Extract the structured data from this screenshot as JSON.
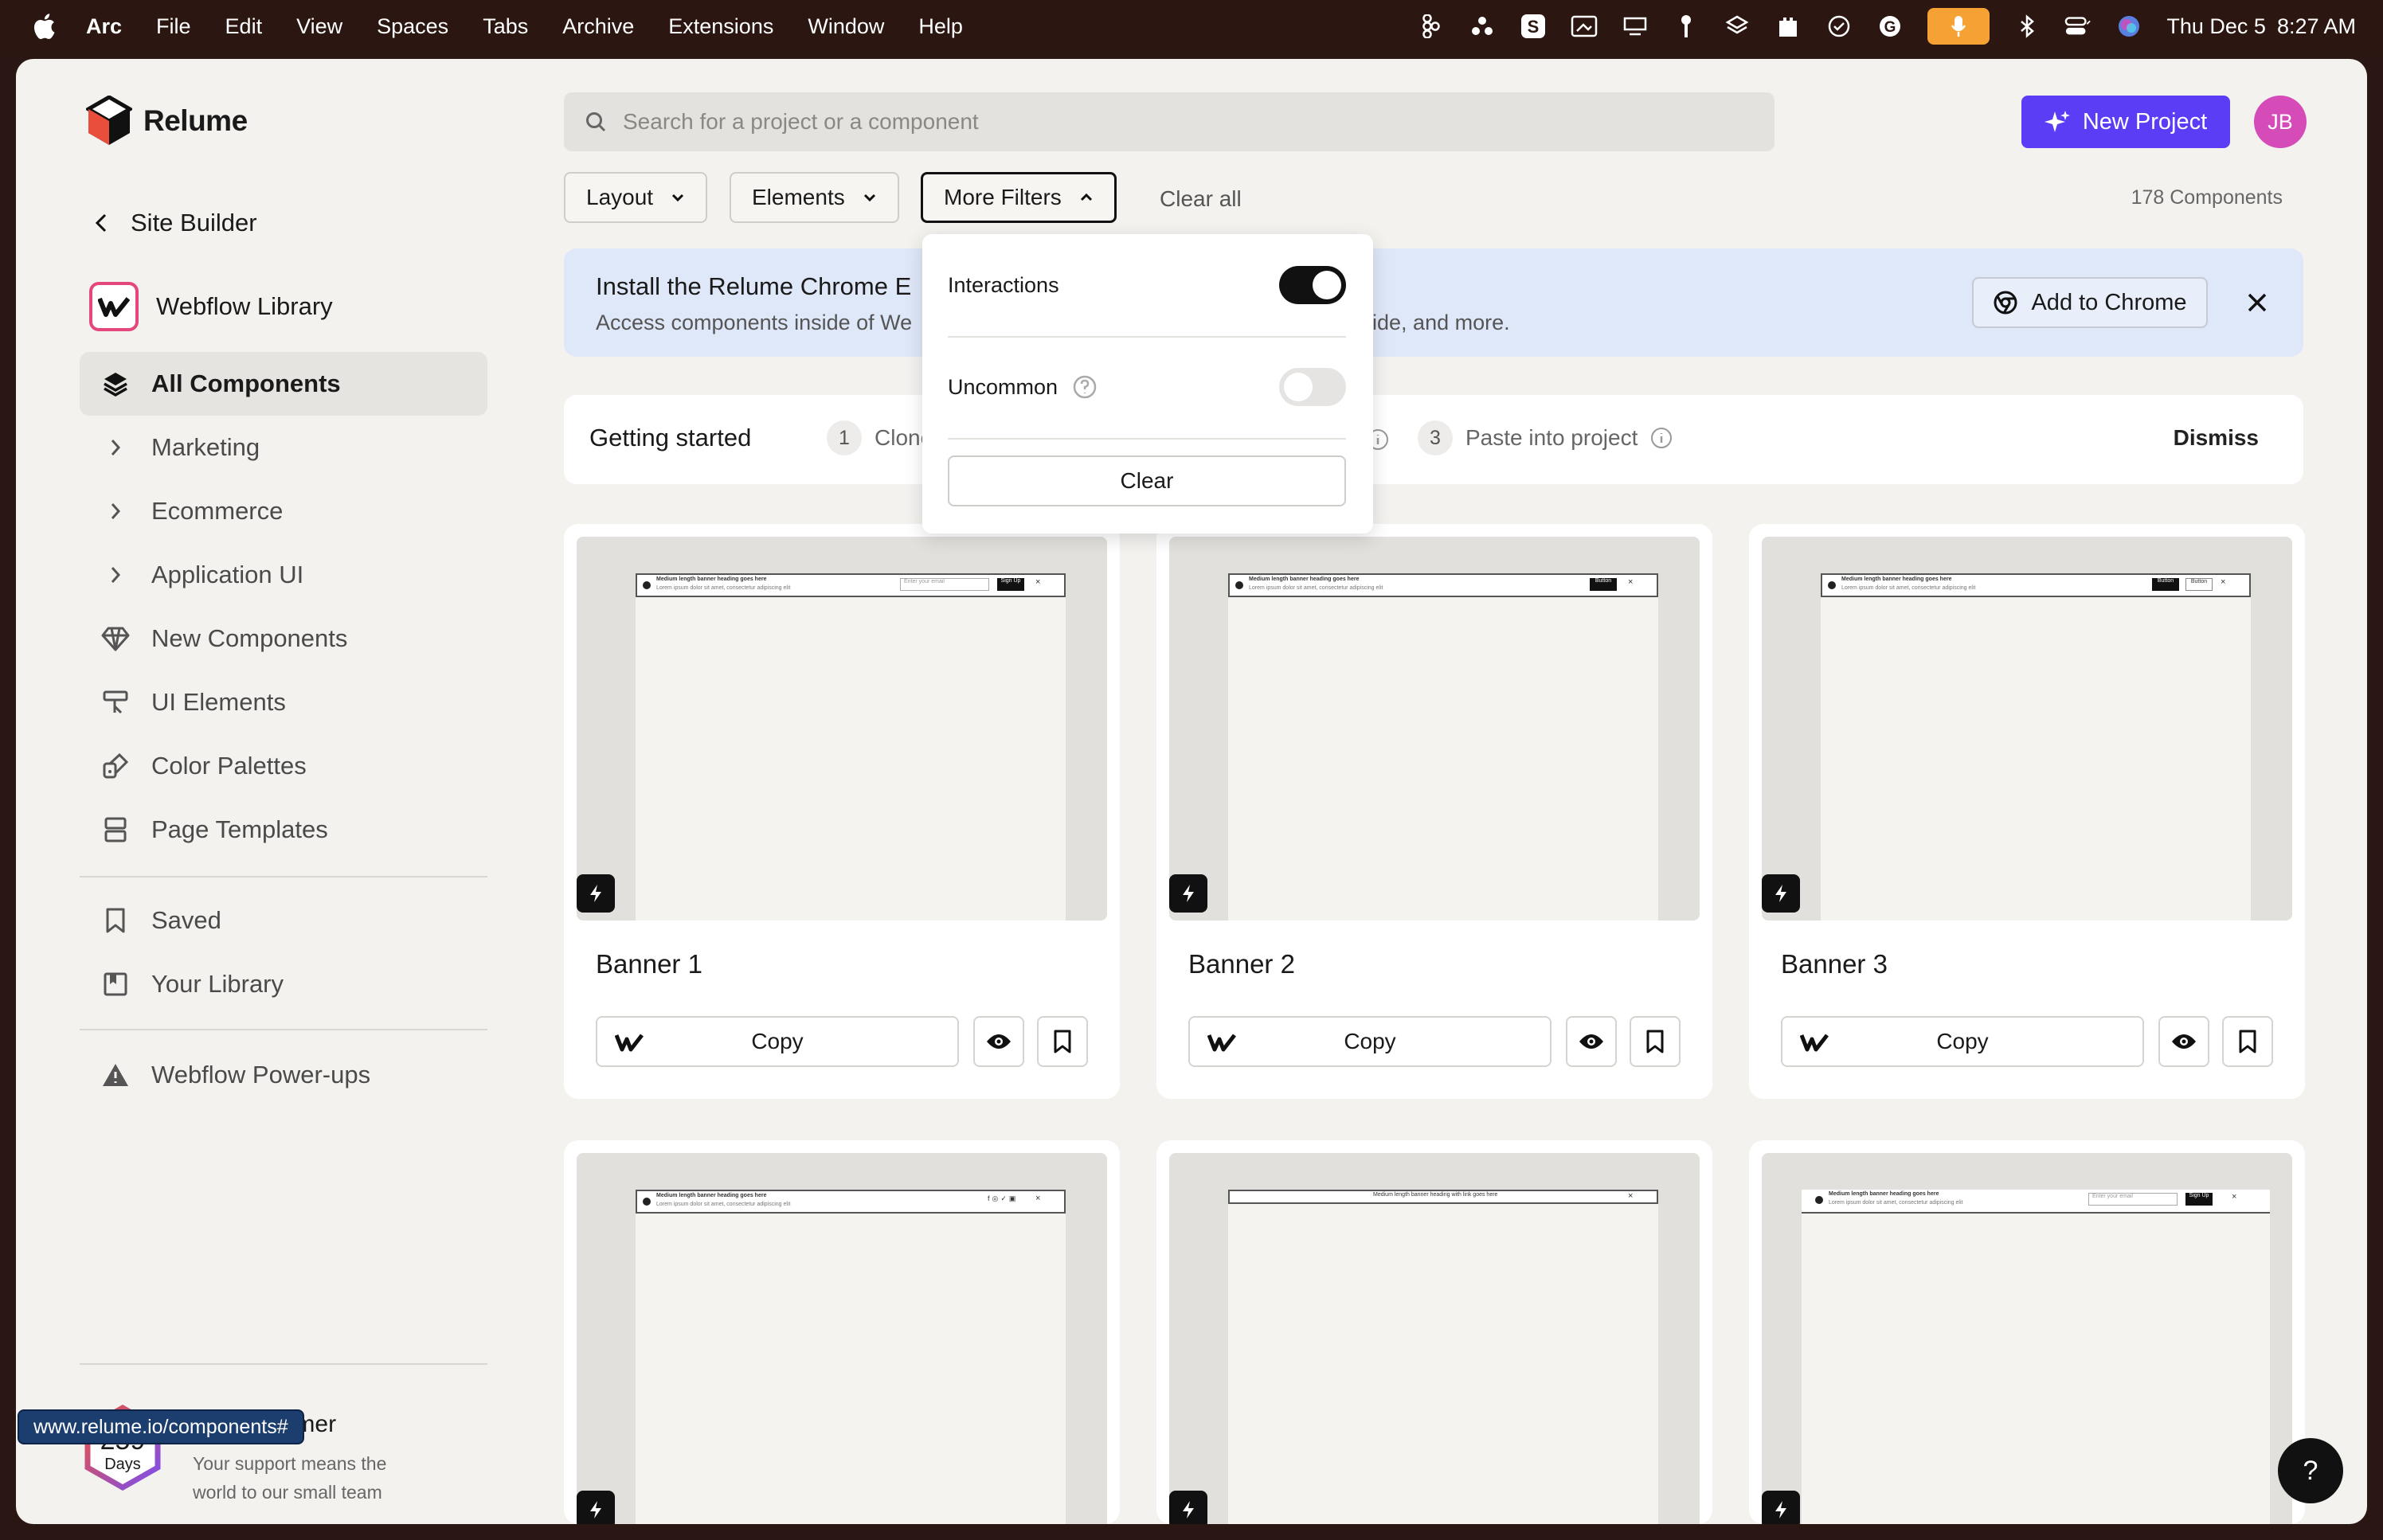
{
  "menubar": {
    "items": [
      "Arc",
      "File",
      "Edit",
      "View",
      "Spaces",
      "Tabs",
      "Archive",
      "Extensions",
      "Window",
      "Help"
    ],
    "date": "Thu Dec 5",
    "time": "8:27 AM"
  },
  "brand": {
    "name": "Relume"
  },
  "sidebar": {
    "back_label": "Site Builder",
    "library_label": "Webflow Library",
    "items": [
      {
        "label": "All Components",
        "icon": "layers-icon"
      },
      {
        "label": "Marketing",
        "icon": "chevron-right-icon"
      },
      {
        "label": "Ecommerce",
        "icon": "chevron-right-icon"
      },
      {
        "label": "Application UI",
        "icon": "chevron-right-icon"
      },
      {
        "label": "New Components",
        "icon": "diamond-icon"
      },
      {
        "label": "UI Elements",
        "icon": "ui-elements-icon"
      },
      {
        "label": "Color Palettes",
        "icon": "palette-icon"
      },
      {
        "label": "Page Templates",
        "icon": "template-icon"
      }
    ],
    "items2": [
      {
        "label": "Saved",
        "icon": "bookmark-icon"
      },
      {
        "label": "Your Library",
        "icon": "library-icon"
      }
    ],
    "powerups": "Webflow Power-ups",
    "expert": {
      "days": "259",
      "days_label": "Days",
      "title": "Expert Lumer",
      "subtitle": "Your support means the world to our small team"
    },
    "url_tooltip": "www.relume.io/components#"
  },
  "search": {
    "placeholder": "Search for a project or a component"
  },
  "header": {
    "new_project": "New Project",
    "avatar_initials": "JB"
  },
  "filters": {
    "layout": "Layout",
    "elements": "Elements",
    "more": "More Filters",
    "clear_all": "Clear all",
    "count": "178 Components"
  },
  "dropdown": {
    "interactions": "Interactions",
    "interactions_on": true,
    "uncommon": "Uncommon",
    "uncommon_on": false,
    "clear": "Clear"
  },
  "chrome_banner": {
    "title": "Install the Relume Chrome E",
    "subtitle": "Access components inside of We",
    "subtitle_end": "uide, and more.",
    "add_button": "Add to Chrome"
  },
  "getting_started": {
    "title": "Getting started",
    "steps": [
      {
        "num": "1",
        "label": "Clone"
      },
      {
        "num": "3",
        "label": "Paste into project"
      }
    ],
    "dismiss": "Dismiss"
  },
  "cards": [
    {
      "title": "Banner 1",
      "copy": "Copy"
    },
    {
      "title": "Banner 2",
      "copy": "Copy"
    },
    {
      "title": "Banner 3",
      "copy": "Copy"
    },
    {
      "title": "",
      "copy": ""
    },
    {
      "title": "",
      "copy": ""
    },
    {
      "title": "",
      "copy": ""
    }
  ],
  "thumb_text": {
    "heading": "Medium length banner heading goes here",
    "body": "Lorem ipsum dolor sit amet, consectetur adipiscing elit",
    "email": "Enter your email",
    "signup": "Sign Up",
    "button": "Button",
    "centered": "Medium length banner heading with link goes here"
  },
  "help": "?"
}
